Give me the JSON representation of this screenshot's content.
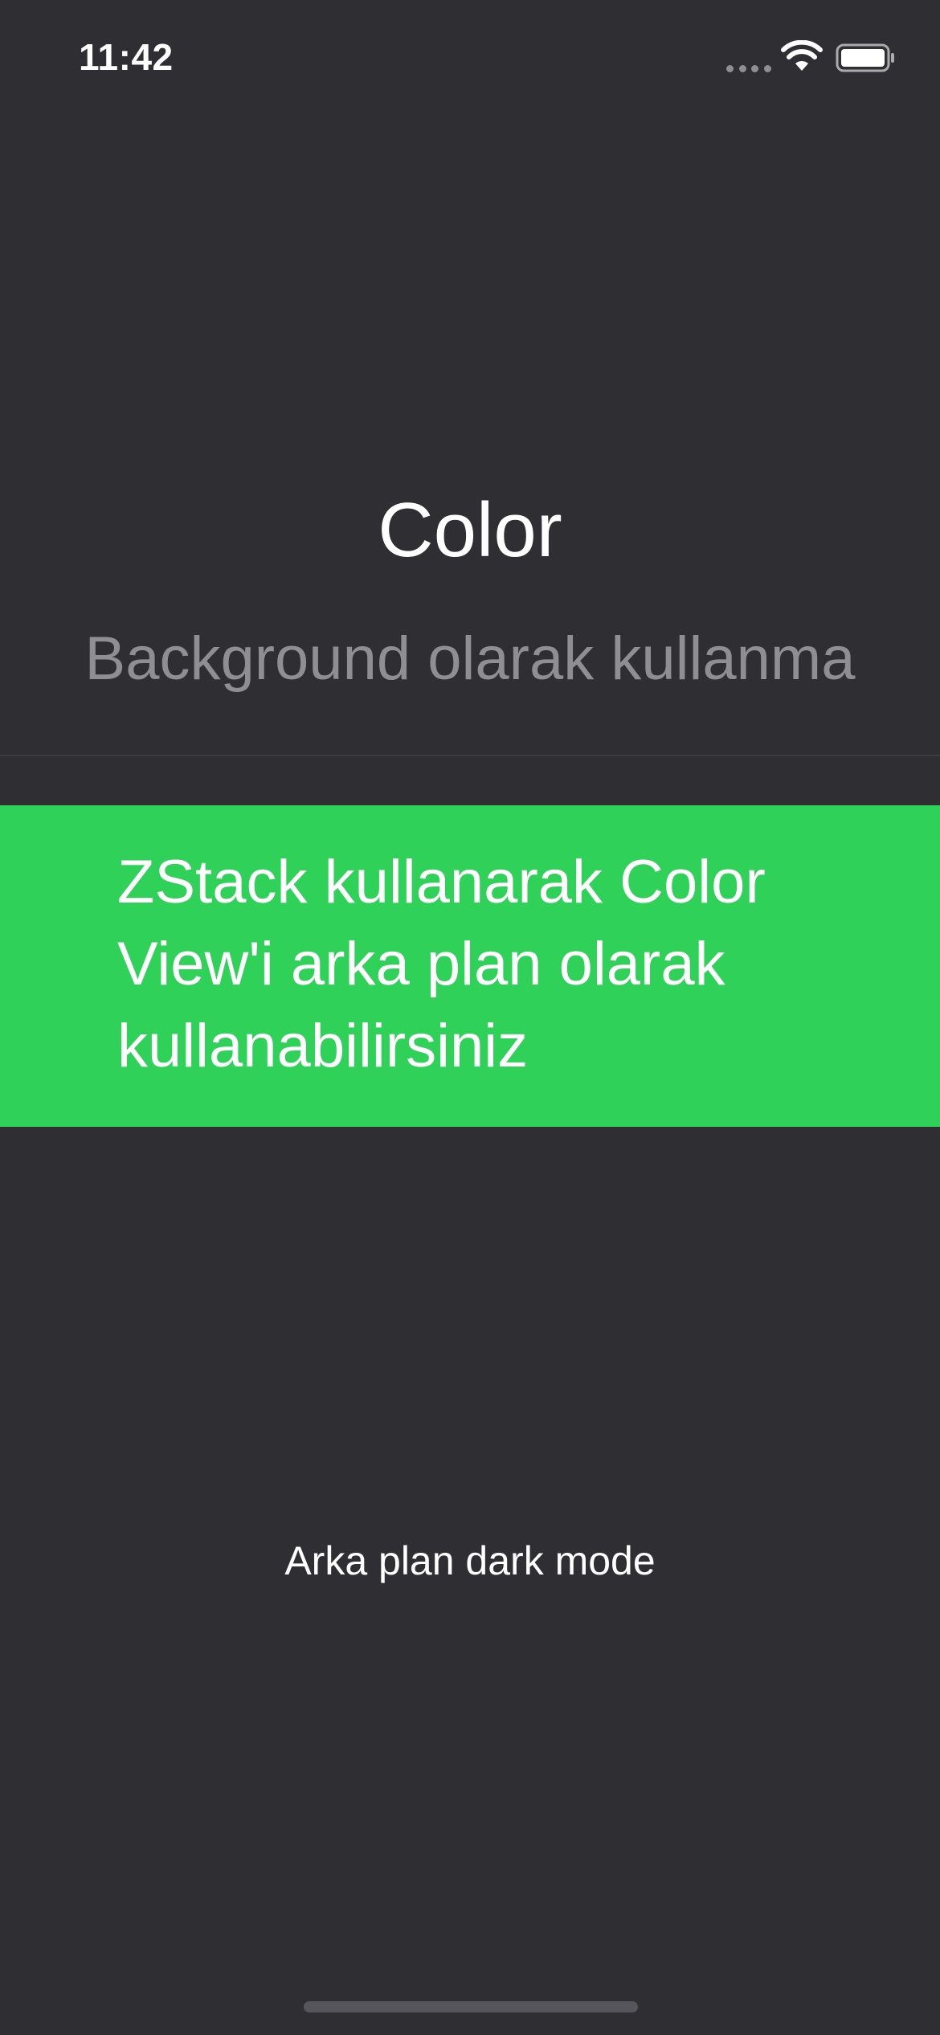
{
  "status_bar": {
    "time": "11:42",
    "icons": [
      "cellular-signal-icon",
      "wifi-icon",
      "battery-icon"
    ]
  },
  "main": {
    "title": "Color",
    "subtitle": "Background olarak kullanma",
    "highlight_text": "ZStack kullanarak Color View'i arka plan olarak kullanabilirsiniz",
    "footer_text": "Arka plan dark mode"
  },
  "colors": {
    "background": "#2E2E33",
    "accent_green": "#30D158",
    "subtitle_gray": "#8E8E93",
    "text_white": "#FFFFFF"
  }
}
